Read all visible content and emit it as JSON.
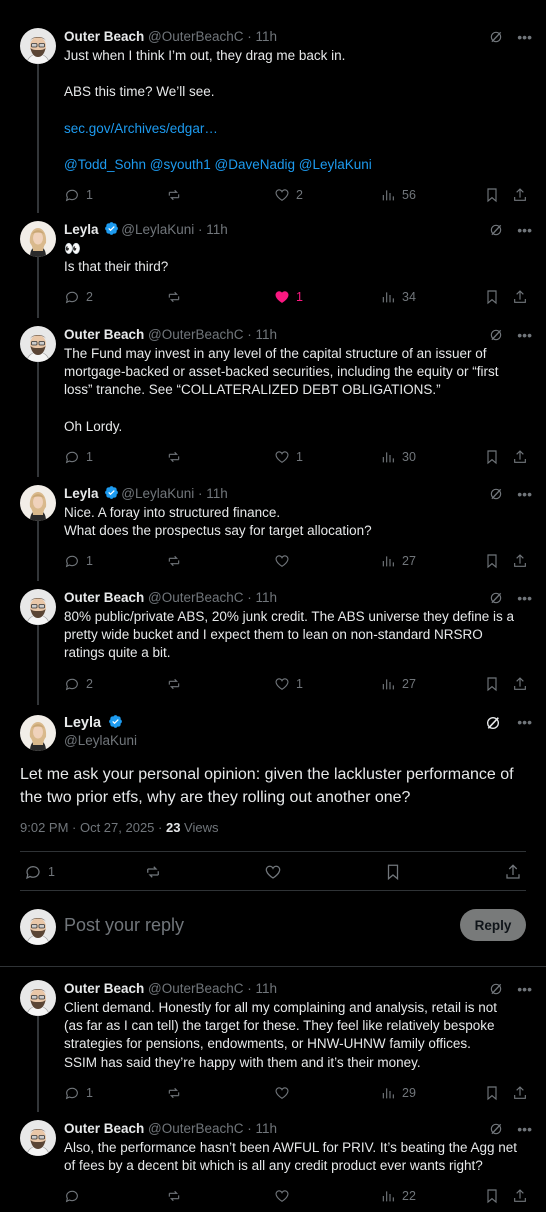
{
  "tweets_before": [
    {
      "name": "Outer Beach",
      "handle": "@OuterBeachC",
      "time": "11h",
      "verified": false,
      "avatar": "outer-beach",
      "body": [
        "Just when I think I’m out, they drag me back in.",
        "",
        "ABS this time? We’ll see.",
        "",
        "sec.gov/Archives/edgar…",
        "",
        "@Todd_Sohn @syouth1 @DaveNadig @LeylaKuni"
      ],
      "link_lines": [
        4,
        6
      ],
      "replies": "1",
      "reposts": "",
      "likes": "2",
      "views": "56",
      "liked": false
    },
    {
      "name": "Leyla",
      "handle": "@LeylaKuni",
      "time": "11h",
      "verified": true,
      "avatar": "leyla",
      "body": [
        "👀",
        "Is that their third?"
      ],
      "link_lines": [],
      "replies": "2",
      "reposts": "",
      "likes": "1",
      "views": "34",
      "liked": true
    },
    {
      "name": "Outer Beach",
      "handle": "@OuterBeachC",
      "time": "11h",
      "verified": false,
      "avatar": "outer-beach",
      "body": [
        "The Fund may invest in any level of the capital structure of an issuer of",
        "mortgage-backed or asset-backed securities, including the equity or “first",
        "loss” tranche. See “COLLATERALIZED DEBT OBLIGATIONS.”",
        "",
        "Oh Lordy."
      ],
      "link_lines": [],
      "replies": "1",
      "reposts": "",
      "likes": "1",
      "views": "30",
      "liked": false
    },
    {
      "name": "Leyla",
      "handle": "@LeylaKuni",
      "time": "11h",
      "verified": true,
      "avatar": "leyla",
      "body": [
        "Nice. A foray into structured finance.",
        "What does the prospectus say for target allocation?"
      ],
      "link_lines": [],
      "replies": "1",
      "reposts": "",
      "likes": "",
      "views": "27",
      "liked": false
    },
    {
      "name": "Outer Beach",
      "handle": "@OuterBeachC",
      "time": "11h",
      "verified": false,
      "avatar": "outer-beach",
      "body": [
        "80% public/private ABS, 20% junk credit. The ABS universe they define is a",
        "pretty wide bucket and I expect them to lean on non-standard NRSRO",
        "ratings quite a bit."
      ],
      "link_lines": [],
      "replies": "2",
      "reposts": "",
      "likes": "1",
      "views": "27",
      "liked": false
    }
  ],
  "focus": {
    "name": "Leyla",
    "handle": "@LeylaKuni",
    "body": "Let me ask your personal opinion: given the lackluster performance of the two prior etfs, why are they rolling out another one?",
    "time": "9:02 PM · Oct 27, 2025 · ",
    "views_count": "23",
    "views_label": " Views",
    "replies": "1"
  },
  "reply_box": {
    "placeholder": "Post your reply",
    "button": "Reply"
  },
  "tweets_after": [
    {
      "name": "Outer Beach",
      "handle": "@OuterBeachC",
      "time": "11h",
      "verified": false,
      "avatar": "outer-beach",
      "body": [
        "Client demand. Honestly for all my complaining and analysis, retail is not",
        "(as far as I can tell) the target for these. They feel like relatively bespoke",
        "strategies for pensions, endowments, or HNW-UHNW family offices.",
        "SSIM has said they’re happy with them and it’s their money."
      ],
      "link_lines": [],
      "replies": "1",
      "reposts": "",
      "likes": "",
      "views": "29",
      "liked": false
    },
    {
      "name": "Outer Beach",
      "handle": "@OuterBeachC",
      "time": "11h",
      "verified": false,
      "avatar": "outer-beach",
      "body": [
        "Also, the performance hasn’t been AWFUL for PRIV. It’s beating the Agg net",
        "of fees by a decent bit which is all any credit product ever wants right?"
      ],
      "link_lines": [],
      "replies": "",
      "reposts": "",
      "likes": "",
      "views": "22",
      "liked": false
    }
  ],
  "colors": {
    "background": "#000000",
    "text": "#e7e9ea",
    "muted": "#71767b",
    "link": "#1d9bf0",
    "like": "#f91880",
    "divider": "#2f3336"
  }
}
